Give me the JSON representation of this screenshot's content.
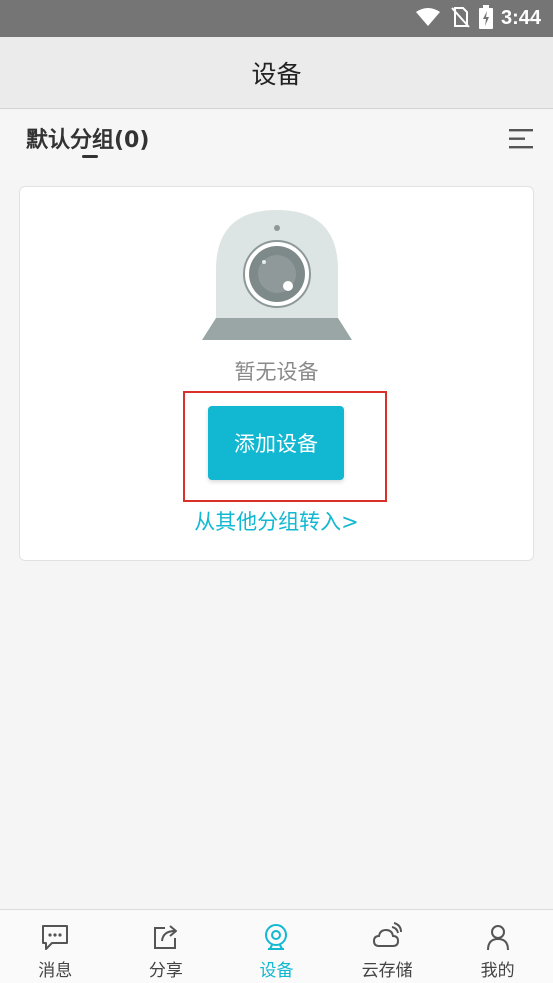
{
  "status_bar": {
    "time": "3:44",
    "icons": [
      "wifi-icon",
      "no-sim-icon",
      "battery-charging-icon"
    ]
  },
  "header": {
    "title": "设备"
  },
  "group": {
    "title": "默认分组(0)",
    "menu_icon": "menu-list-icon"
  },
  "empty_state": {
    "icon": "camera-icon",
    "message": "暂无设备",
    "add_button_label": "添加设备",
    "move_link": "从其他分组转入>"
  },
  "colors": {
    "accent": "#12b8d1",
    "highlight_border": "#d9302a",
    "status_bar": "#757575",
    "header_bg": "#ebebeb"
  },
  "tabs": [
    {
      "label": "消息",
      "icon": "message-icon",
      "active": false
    },
    {
      "label": "分享",
      "icon": "share-icon",
      "active": false
    },
    {
      "label": "设备",
      "icon": "device-icon",
      "active": true
    },
    {
      "label": "云存储",
      "icon": "cloud-storage-icon",
      "active": false
    },
    {
      "label": "我的",
      "icon": "profile-icon",
      "active": false
    }
  ]
}
